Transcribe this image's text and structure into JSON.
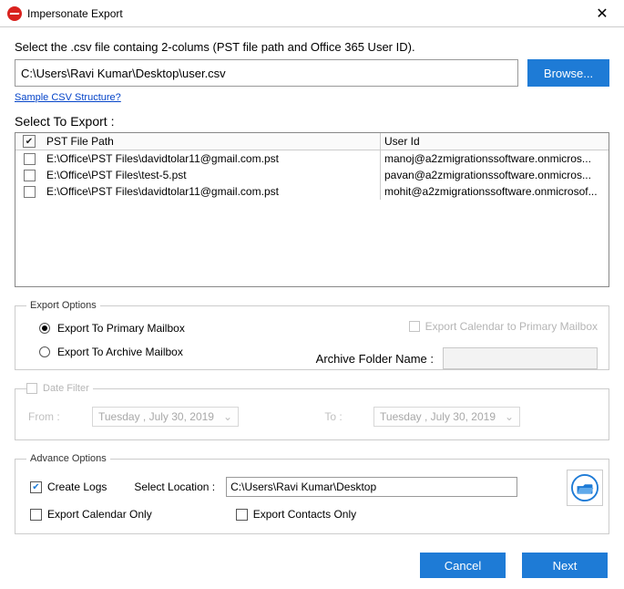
{
  "window": {
    "title": "Impersonate Export"
  },
  "instruction": "Select the .csv file containg 2-colums (PST file path and Office 365 User ID).",
  "csv": {
    "path": "C:\\Users\\Ravi Kumar\\Desktop\\user.csv",
    "browse_label": "Browse...",
    "structure_link": "Sample CSV Structure?"
  },
  "export_select": {
    "label": "Select To Export :",
    "columns": {
      "path": "PST File Path",
      "user": "User Id"
    },
    "rows": [
      {
        "path": "E:\\Office\\PST Files\\davidtolar11@gmail.com.pst",
        "user": "manoj@a2zmigrationssoftware.onmicros..."
      },
      {
        "path": "E:\\Office\\PST Files\\test-5.pst",
        "user": "pavan@a2zmigrationssoftware.onmicros..."
      },
      {
        "path": "E:\\Office\\PST Files\\davidtolar11@gmail.com.pst",
        "user": "mohit@a2zmigrationssoftware.onmicrosof..."
      }
    ]
  },
  "export_options": {
    "legend": "Export Options",
    "primary_label": "Export To Primary Mailbox",
    "archive_label": "Export To Archive Mailbox",
    "calendar_primary_label": "Export Calendar to Primary Mailbox",
    "archive_folder_label": "Archive Folder Name :"
  },
  "date_filter": {
    "legend": "Date Filter",
    "from_label": "From :",
    "to_label": "To :",
    "from_value": "Tuesday ,      July    30, 2019",
    "to_value": "Tuesday ,      July    30, 2019"
  },
  "advance": {
    "legend": "Advance Options",
    "create_logs_label": "Create Logs",
    "select_location_label": "Select Location :",
    "location_value": "C:\\Users\\Ravi Kumar\\Desktop",
    "export_calendar_only_label": "Export Calendar Only",
    "export_contacts_only_label": "Export Contacts Only"
  },
  "footer": {
    "cancel": "Cancel",
    "next": "Next"
  }
}
